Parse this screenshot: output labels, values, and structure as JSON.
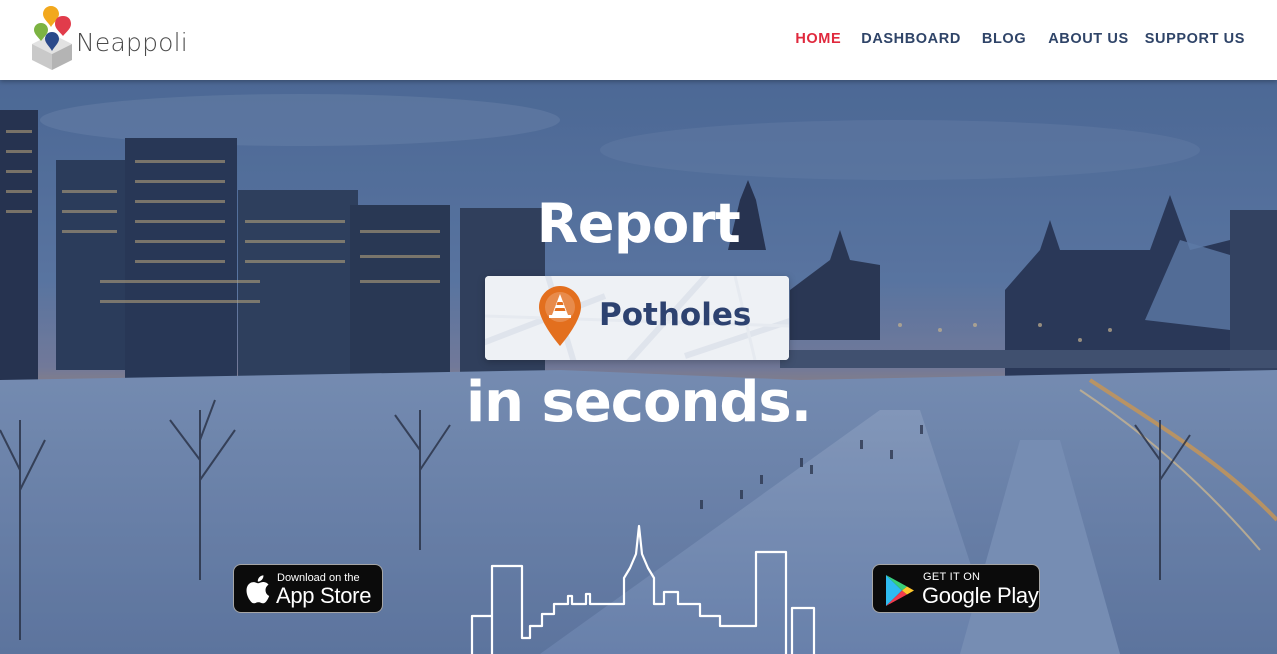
{
  "header": {
    "brand": "Neappoli",
    "nav": [
      {
        "label": "HOME",
        "active": true
      },
      {
        "label": "DASHBOARD",
        "active": false
      },
      {
        "label": "BLOG",
        "active": false
      },
      {
        "label": "ABOUT US",
        "active": false
      },
      {
        "label": "SUPPORT US",
        "active": false
      }
    ]
  },
  "hero": {
    "headline_top": "Report",
    "highlight": "Potholes",
    "headline_bottom": "in seconds.",
    "app_store": {
      "small": "Download on the",
      "big": "App Store",
      "icon": "apple-icon"
    },
    "google_play": {
      "small": "GET IT ON",
      "big": "Google Play",
      "icon": "google-play-icon"
    },
    "background": "city-canal-winter-dusk-photo"
  },
  "colors": {
    "nav_text": "#2f4468",
    "nav_active": "#e0293d",
    "pill_text": "#2d4270",
    "pin_orange": "#e36f1e",
    "logo_orange": "#f2a81d",
    "logo_red": "#e13c4b",
    "logo_green": "#7cb342",
    "logo_blue": "#2b4a8b"
  }
}
